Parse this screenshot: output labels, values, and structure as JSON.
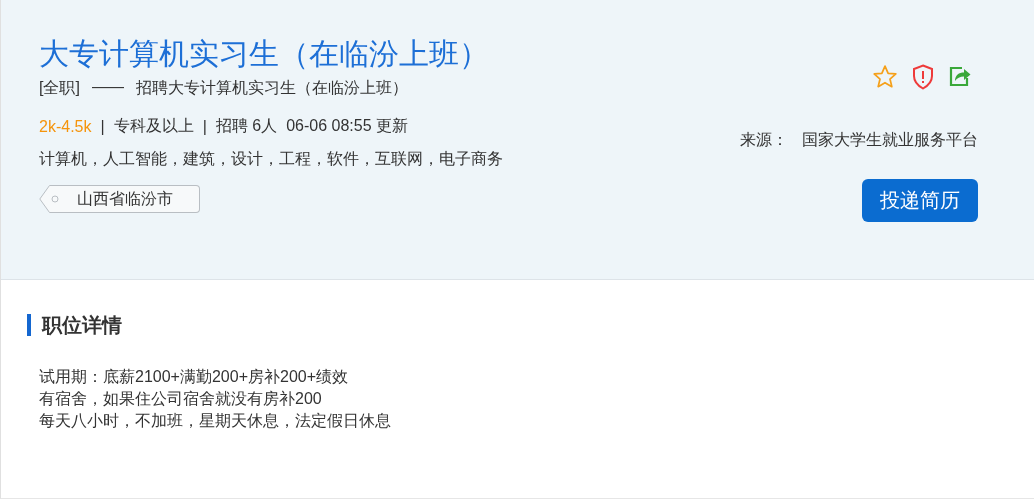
{
  "job": {
    "title": "大专计算机实习生（在临汾上班）",
    "employment_type": "[全职]",
    "dash": "——",
    "subtitle": "招聘大专计算机实习生（在临汾上班）",
    "salary": "2k-4.5k",
    "separator": "|",
    "education": "专科及以上",
    "headcount": "招聘 6人",
    "updated": "06-06 08:55 更新",
    "tags": "计算机，人工智能，建筑，设计，工程，软件，互联网，电子商务",
    "location": "山西省临汾市",
    "source_label": "来源：",
    "source": "国家大学生就业服务平台",
    "apply_button": "投递简历"
  },
  "details": {
    "heading": "职位详情",
    "lines": [
      "试用期：底薪2100+满勤200+房补200+绩效",
      "有宿舍，如果住公司宿舍就没有房补200",
      "每天八小时，不加班，星期天休息，法定假日休息"
    ]
  }
}
